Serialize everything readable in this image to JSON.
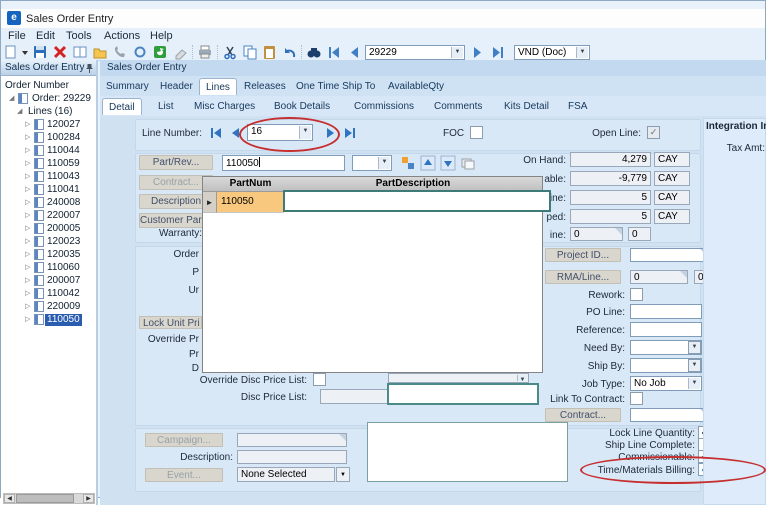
{
  "window": {
    "title": "Sales Order Entry"
  },
  "menu": {
    "items": [
      "File",
      "Edit",
      "Tools",
      "Actions",
      "Help"
    ]
  },
  "toolbar": {
    "record_value": "29229",
    "view_value": "VND (Doc)",
    "icons": [
      "new",
      "save",
      "delete",
      "memo",
      "folder",
      "call",
      "attachment",
      "refresh",
      "clear",
      "print",
      "cut",
      "copy",
      "paste",
      "undo",
      "search",
      "first",
      "previous",
      "next",
      "last"
    ]
  },
  "sidebar": {
    "header": "Sales Order Entry",
    "tree": {
      "root_label": "Order Number",
      "order_label": "Order: 29229",
      "lines_label": "Lines (16)",
      "line_items": [
        "120027",
        "100284",
        "110044",
        "110059",
        "110043",
        "110041",
        "240008",
        "220007",
        "200005",
        "120023",
        "120035",
        "110060",
        "200007",
        "110042",
        "220009",
        "110050"
      ],
      "selected_item": "110050"
    }
  },
  "main": {
    "caption": "Sales Order Entry",
    "tabs": [
      "Summary",
      "Header",
      "Lines",
      "Releases",
      "One Time Ship To",
      "AvailableQty"
    ],
    "active_tab": "Lines",
    "subtabs": [
      "Detail",
      "List",
      "Misc Charges",
      "Book Details",
      "Commissions",
      "Comments",
      "Kits Detail",
      "FSA"
    ],
    "active_subtab": "Detail",
    "line_number": {
      "label": "Line Number:",
      "value": "16"
    },
    "foc": {
      "label": "FOC",
      "checked": false,
      "check": ""
    },
    "open_line": {
      "label": "Open Line:",
      "checked": true,
      "check": "✓"
    },
    "part": {
      "part_rev_label": "Part/Rev...",
      "part_value": "110050",
      "contract_label": "Contract...",
      "description_label": "Description",
      "customer_part_label": "Customer Part...",
      "warranty_label": "Warranty:"
    },
    "quantities": {
      "rows": [
        {
          "label": "On Hand:",
          "value": "4,279",
          "uom": "CAY"
        },
        {
          "label": "able:",
          "value": "-9,779",
          "uom": "CAY"
        },
        {
          "label": "ine:",
          "value": "5",
          "uom": "CAY"
        },
        {
          "label": "ped:",
          "value": "5",
          "uom": "CAY"
        }
      ],
      "line_row": {
        "label": "ine:",
        "value1": "0",
        "value2": "0"
      }
    },
    "part_search_dropdown": {
      "columns": [
        "PartNum",
        "PartDescription"
      ],
      "row": {
        "part_num": "110050",
        "part_description": ""
      }
    },
    "pricing": {
      "fragments": [
        "Order",
        "P",
        "Ur",
        "Lock Unit Pri",
        "Override Pr",
        "Pr",
        "D"
      ],
      "override_disc_label": "Override Disc Price List:",
      "override_disc_check": "",
      "disc_price_list_label": "Disc Price List:",
      "disc_price_list_value": ""
    },
    "detail_right": {
      "project_id_label": "Project ID...",
      "project_id_value": "",
      "rma_line_label": "RMA/Line...",
      "rma_value1": "0",
      "rma_value2": "0",
      "rework_label": "Rework:",
      "rework_check": "",
      "po_line_label": "PO Line:",
      "po_line_value": "",
      "reference_label": "Reference:",
      "reference_value": "",
      "need_by_label": "Need By:",
      "need_by_value": "",
      "ship_by_label": "Ship By:",
      "ship_by_value": "",
      "job_type_label": "Job Type:",
      "job_type_value": "No Job",
      "link_to_contract_label": "Link To Contract:",
      "link_to_contract_check": "",
      "contract_label": "Contract...",
      "contract_value": ""
    },
    "marketing": {
      "campaign_label": "Campaign...",
      "campaign_value": "",
      "description_label": "Description:",
      "description_value": "",
      "event_label": "Event...",
      "event_value": "None Selected"
    },
    "line_flags": [
      {
        "label": "Lock Line Quantity:",
        "checked": true,
        "check": "✓"
      },
      {
        "label": "Ship Line Complete:",
        "checked": false,
        "check": ""
      },
      {
        "label": "Commissionable:",
        "checked": true,
        "check": "✓"
      },
      {
        "label": "Time/Materials Billing:",
        "checked": true,
        "check": "✓"
      }
    ],
    "integration": {
      "header": "Integration Infor",
      "tax_amt_label": "Tax Amt:"
    }
  },
  "annotations": {
    "color": "#c52f2f"
  }
}
